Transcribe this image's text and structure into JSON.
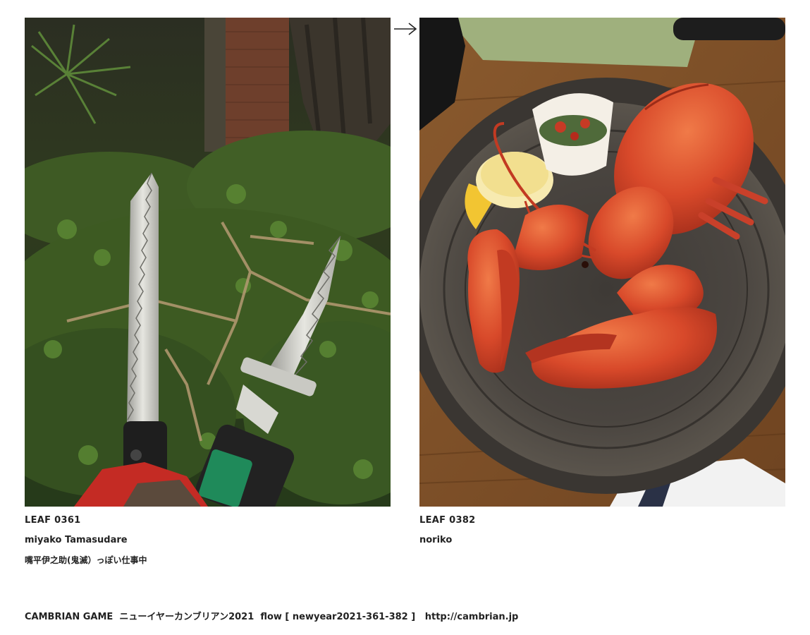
{
  "leaves": [
    {
      "id": "LEAF 0361",
      "author": "miyako Tamasudare",
      "caption": "嘴平伊之助(鬼滅）っぽい仕事中",
      "photo_subject": "two-pruning-saws-in-garden"
    },
    {
      "id": "LEAF 0382",
      "author": "noriko",
      "caption": "",
      "photo_subject": "red-lobster-on-plate"
    }
  ],
  "arrow": {
    "icon": "right-arrow-icon"
  },
  "footer": {
    "brand": "CAMBRIAN GAME",
    "event": "ニューイヤーカンブリアン2021",
    "flow_label": "flow [ newyear2021-361-382 ]",
    "url": "http://cambrian.jp"
  }
}
